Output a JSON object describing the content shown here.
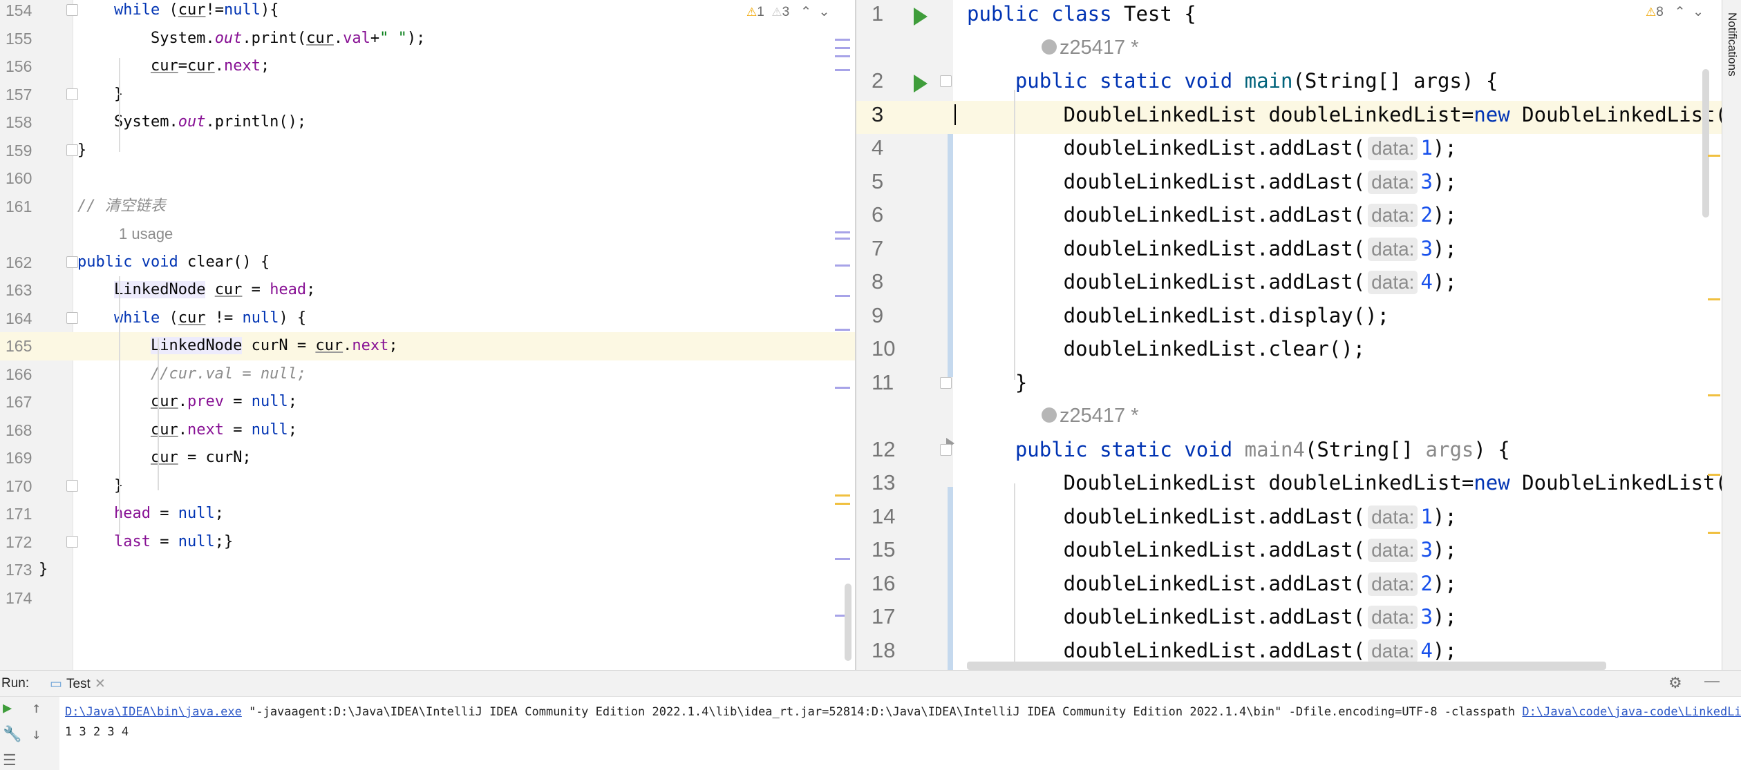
{
  "left_editor": {
    "inspection": {
      "warnings": "1",
      "weak_warnings": "3"
    },
    "lines": [
      {
        "num": "154",
        "segs": [
          [
            "",
            "    "
          ],
          [
            "kw",
            "while"
          ],
          [
            "",
            " ("
          ],
          [
            "und",
            "cur"
          ],
          [
            "",
            "!="
          ],
          [
            "kw",
            "null"
          ],
          [
            "",
            "){"
          ]
        ]
      },
      {
        "num": "155",
        "segs": [
          [
            "",
            "        System."
          ],
          [
            "st",
            "out"
          ],
          [
            "",
            ".print("
          ],
          [
            "und",
            "cur"
          ],
          [
            "",
            "."
          ],
          [
            "fld",
            "val"
          ],
          [
            "",
            "+"
          ],
          [
            "str",
            "\" \""
          ],
          [
            "",
            ");"
          ]
        ]
      },
      {
        "num": "156",
        "segs": [
          [
            "",
            "        "
          ],
          [
            "und",
            "cur"
          ],
          [
            "",
            "="
          ],
          [
            "und",
            "cur"
          ],
          [
            "",
            "."
          ],
          [
            "fld",
            "next"
          ],
          [
            "",
            ";"
          ]
        ]
      },
      {
        "num": "157",
        "segs": [
          [
            "",
            "    }"
          ]
        ]
      },
      {
        "num": "158",
        "segs": [
          [
            "",
            "    System."
          ],
          [
            "st",
            "out"
          ],
          [
            "",
            ".println();"
          ]
        ]
      },
      {
        "num": "159",
        "segs": [
          [
            "",
            "}"
          ]
        ]
      },
      {
        "num": "160",
        "segs": []
      },
      {
        "num": "161",
        "segs": [
          [
            "cmt",
            "// 清空链表"
          ]
        ]
      },
      {
        "num": "",
        "meta": "1 usage"
      },
      {
        "num": "162",
        "segs": [
          [
            "kw",
            "public"
          ],
          [
            "",
            " "
          ],
          [
            "kw",
            "void"
          ],
          [
            "",
            " clear() {"
          ]
        ]
      },
      {
        "num": "163",
        "segs": [
          [
            "",
            "    "
          ],
          [
            "cls",
            "LinkedNode"
          ],
          [
            "",
            " "
          ],
          [
            "und",
            "cur"
          ],
          [
            "",
            " = "
          ],
          [
            "fld",
            "head"
          ],
          [
            "",
            ";"
          ]
        ]
      },
      {
        "num": "164",
        "segs": [
          [
            "",
            "    "
          ],
          [
            "kw",
            "while"
          ],
          [
            "",
            " ("
          ],
          [
            "und",
            "cur"
          ],
          [
            "",
            " != "
          ],
          [
            "kw",
            "null"
          ],
          [
            "",
            ") {"
          ]
        ]
      },
      {
        "num": "165",
        "hl": true,
        "segs": [
          [
            "",
            "        "
          ],
          [
            "cls",
            "LinkedNode"
          ],
          [
            "",
            " curN = "
          ],
          [
            "und",
            "cur"
          ],
          [
            "",
            "."
          ],
          [
            "fld",
            "next"
          ],
          [
            "",
            ";"
          ]
        ]
      },
      {
        "num": "166",
        "segs": [
          [
            "",
            "        "
          ],
          [
            "cmt",
            "//cur.val = null;"
          ]
        ]
      },
      {
        "num": "167",
        "segs": [
          [
            "",
            "        "
          ],
          [
            "und",
            "cur"
          ],
          [
            "",
            "."
          ],
          [
            "fld",
            "prev"
          ],
          [
            "",
            " = "
          ],
          [
            "kw",
            "null"
          ],
          [
            "",
            ";"
          ]
        ]
      },
      {
        "num": "168",
        "segs": [
          [
            "",
            "        "
          ],
          [
            "und",
            "cur"
          ],
          [
            "",
            "."
          ],
          [
            "fld",
            "next"
          ],
          [
            "",
            " = "
          ],
          [
            "kw",
            "null"
          ],
          [
            "",
            ";"
          ]
        ]
      },
      {
        "num": "169",
        "segs": [
          [
            "",
            "        "
          ],
          [
            "und",
            "cur"
          ],
          [
            "",
            " = curN;"
          ]
        ]
      },
      {
        "num": "170",
        "segs": [
          [
            "",
            "    }"
          ]
        ]
      },
      {
        "num": "171",
        "segs": [
          [
            "",
            "    "
          ],
          [
            "fld",
            "head"
          ],
          [
            "",
            " = "
          ],
          [
            "kw",
            "null"
          ],
          [
            "",
            ";"
          ]
        ]
      },
      {
        "num": "172",
        "segs": [
          [
            "",
            "    "
          ],
          [
            "fld",
            "last"
          ],
          [
            "",
            " = "
          ],
          [
            "kw",
            "null"
          ],
          [
            "",
            ";}"
          ]
        ]
      },
      {
        "num": "173",
        "segs": [
          [
            "",
            "}"
          ]
        ],
        "outdent": true
      },
      {
        "num": "174",
        "segs": []
      }
    ]
  },
  "right_editor": {
    "inspection": {
      "warnings": "8"
    },
    "lines": [
      {
        "num": "1",
        "run": true,
        "segs": [
          [
            "kw",
            "public"
          ],
          [
            "",
            " "
          ],
          [
            "kw",
            "class"
          ],
          [
            "",
            " Test {"
          ]
        ]
      },
      {
        "num": "",
        "meta": "z25417 *",
        "person": true
      },
      {
        "num": "2",
        "run": true,
        "segs": [
          [
            "",
            "    "
          ],
          [
            "kw",
            "public"
          ],
          [
            "",
            " "
          ],
          [
            "kw",
            "static"
          ],
          [
            "",
            " "
          ],
          [
            "kw",
            "void"
          ],
          [
            "",
            " "
          ],
          [
            "meth",
            "main"
          ],
          [
            "",
            "(String[] args) {"
          ]
        ]
      },
      {
        "num": "3",
        "hl": true,
        "caret": true,
        "segs": [
          [
            "",
            "        DoubleLinkedList doubleLinkedList="
          ],
          [
            "kw",
            "new"
          ],
          [
            "",
            " DoubleLinkedList()"
          ]
        ]
      },
      {
        "num": "4",
        "segs": [
          [
            "",
            "        doubleLinkedList.addLast("
          ],
          [
            "hint",
            "data:"
          ],
          [
            "num",
            "1"
          ],
          [
            "",
            ");"
          ]
        ]
      },
      {
        "num": "5",
        "segs": [
          [
            "",
            "        doubleLinkedList.addLast("
          ],
          [
            "hint",
            "data:"
          ],
          [
            "num",
            "3"
          ],
          [
            "",
            ");"
          ]
        ]
      },
      {
        "num": "6",
        "segs": [
          [
            "",
            "        doubleLinkedList.addLast("
          ],
          [
            "hint",
            "data:"
          ],
          [
            "num",
            "2"
          ],
          [
            "",
            ");"
          ]
        ]
      },
      {
        "num": "7",
        "segs": [
          [
            "",
            "        doubleLinkedList.addLast("
          ],
          [
            "hint",
            "data:"
          ],
          [
            "num",
            "3"
          ],
          [
            "",
            ");"
          ]
        ]
      },
      {
        "num": "8",
        "segs": [
          [
            "",
            "        doubleLinkedList.addLast("
          ],
          [
            "hint",
            "data:"
          ],
          [
            "num",
            "4"
          ],
          [
            "",
            ");"
          ]
        ]
      },
      {
        "num": "9",
        "segs": [
          [
            "",
            "        doubleLinkedList.display();"
          ]
        ]
      },
      {
        "num": "10",
        "segs": [
          [
            "",
            "        doubleLinkedList.clear();"
          ]
        ]
      },
      {
        "num": "11",
        "segs": [
          [
            "",
            "    }"
          ]
        ]
      },
      {
        "num": "",
        "meta": "z25417 *",
        "person": true
      },
      {
        "num": "12",
        "segs": [
          [
            "",
            "    "
          ],
          [
            "kw",
            "public"
          ],
          [
            "",
            " "
          ],
          [
            "kw",
            "static"
          ],
          [
            "",
            " "
          ],
          [
            "kw",
            "void"
          ],
          [
            "",
            " "
          ],
          [
            "grayid",
            "main4"
          ],
          [
            "",
            "(String[] "
          ],
          [
            "grayid",
            "args"
          ],
          [
            "",
            ") {"
          ]
        ]
      },
      {
        "num": "13",
        "segs": [
          [
            "",
            "        DoubleLinkedList doubleLinkedList="
          ],
          [
            "kw",
            "new"
          ],
          [
            "",
            " DoubleLinkedList()"
          ]
        ]
      },
      {
        "num": "14",
        "segs": [
          [
            "",
            "        doubleLinkedList.addLast("
          ],
          [
            "hint",
            "data:"
          ],
          [
            "num",
            "1"
          ],
          [
            "",
            ");"
          ]
        ]
      },
      {
        "num": "15",
        "segs": [
          [
            "",
            "        doubleLinkedList.addLast("
          ],
          [
            "hint",
            "data:"
          ],
          [
            "num",
            "3"
          ],
          [
            "",
            ");"
          ]
        ]
      },
      {
        "num": "16",
        "segs": [
          [
            "",
            "        doubleLinkedList.addLast("
          ],
          [
            "hint",
            "data:"
          ],
          [
            "num",
            "2"
          ],
          [
            "",
            ");"
          ]
        ]
      },
      {
        "num": "17",
        "segs": [
          [
            "",
            "        doubleLinkedList.addLast("
          ],
          [
            "hint",
            "data:"
          ],
          [
            "num",
            "3"
          ],
          [
            "",
            ");"
          ]
        ]
      },
      {
        "num": "18",
        "segs": [
          [
            "",
            "        doubleLinkedList.addLast("
          ],
          [
            "hint",
            "data:"
          ],
          [
            "num",
            "4"
          ],
          [
            "",
            ");"
          ]
        ]
      }
    ]
  },
  "notifications_label": "Notifications",
  "run_panel": {
    "label": "Run:",
    "tab_label": "Test",
    "command_link": "D:\\Java\\IDEA\\bin\\java.exe",
    "command_rest": " \"-javaagent:D:\\Java\\IDEA\\IntelliJ IDEA Community Edition 2022.1.4\\lib\\idea_rt.jar=52814:D:\\Java\\IDEA\\IntelliJ IDEA Community Edition 2022.1.4\\bin\" -Dfile.encoding=UTF-8 -classpath ",
    "classpath_link": "D:\\Java\\code\\java-code\\LinkedList",
    "output_line": "1 3 2 3 4"
  },
  "colors": {
    "keyword": "#0033b3",
    "field": "#871094",
    "string": "#067d17",
    "number": "#1750eb",
    "comment": "#8c8c8c",
    "run": "#3f9d3b",
    "warning": "#f0a600",
    "current_line": "#fcf8e3"
  }
}
